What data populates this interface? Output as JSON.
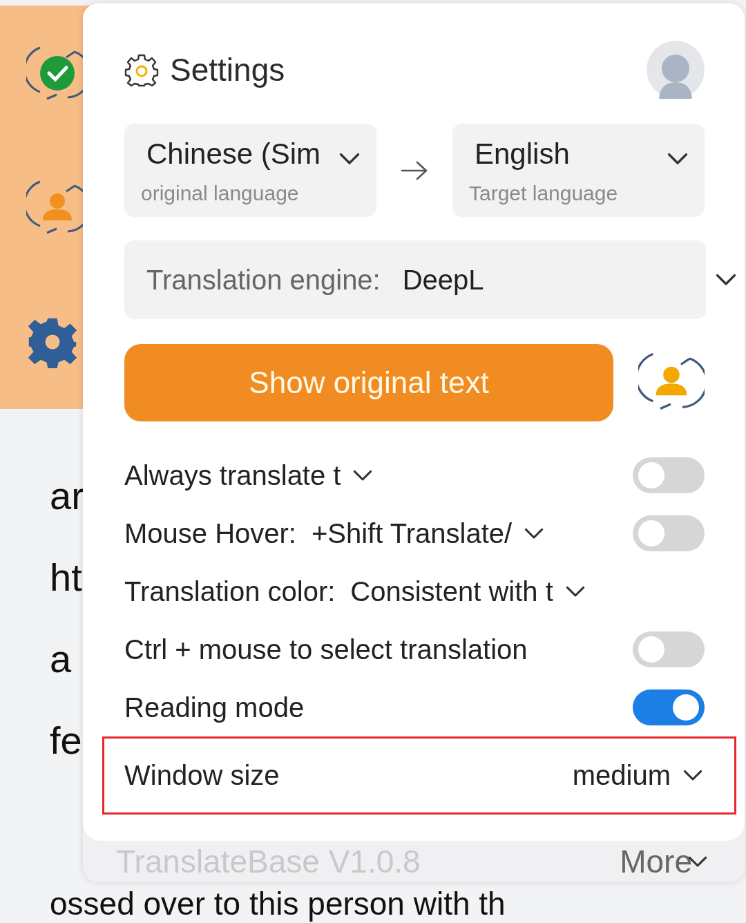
{
  "background_text": {
    "lines": [
      "ar",
      "ht",
      "a",
      "fe"
    ],
    "last_line": "ossed over to this person with th"
  },
  "side_toolbar": {
    "items": [
      {
        "kind": "status_ok"
      },
      {
        "kind": "user_switch"
      },
      {
        "kind": "settings"
      }
    ]
  },
  "panel": {
    "title": "Settings",
    "source_language": {
      "value": "Chinese (Sim",
      "caption": "original language"
    },
    "target_language": {
      "value": "English",
      "caption": "Target language"
    },
    "engine": {
      "label": "Translation engine:",
      "value": "DeepL"
    },
    "primary_button": "Show original text",
    "options": [
      {
        "kind": "select_toggle",
        "label": "Always translate t",
        "on": false,
        "highlighted": false
      },
      {
        "kind": "select_toggle",
        "label": "Mouse Hover:",
        "value": "+Shift Translate/",
        "on": false,
        "highlighted": false
      },
      {
        "kind": "select",
        "label": "Translation color:",
        "value": "Consistent with t",
        "highlighted": false
      },
      {
        "kind": "toggle",
        "label": "Ctrl + mouse to select translation",
        "on": false,
        "highlighted": false
      },
      {
        "kind": "toggle",
        "label": "Reading mode",
        "on": true,
        "highlighted": false
      },
      {
        "kind": "size_select",
        "label": "Window size",
        "value": "medium",
        "highlighted": true
      }
    ],
    "footer": {
      "version": "TranslateBase V1.0.8",
      "more": "More"
    }
  }
}
